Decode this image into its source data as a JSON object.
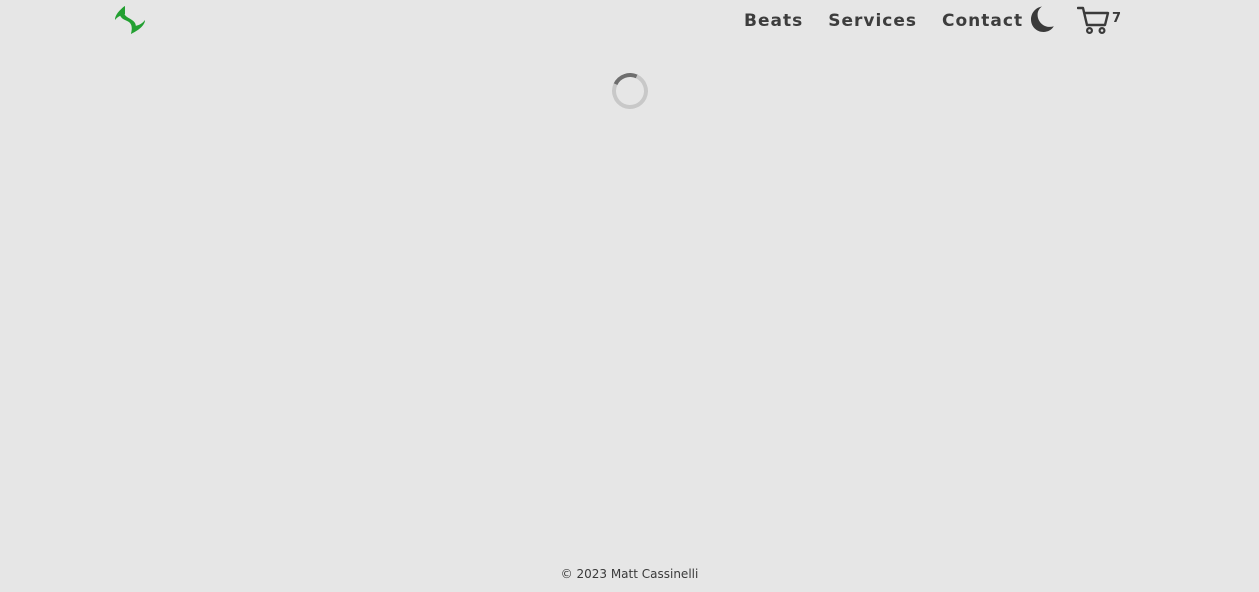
{
  "header": {
    "nav": [
      {
        "label": "Beats"
      },
      {
        "label": "Services"
      },
      {
        "label": "Contact"
      }
    ],
    "theme_toggle_icon": "moon-icon",
    "cart": {
      "icon": "cart-icon",
      "count": "7"
    },
    "logo_icon": "logo-icon"
  },
  "main": {
    "loading_indicator": "spinner"
  },
  "footer": {
    "copyright": "© 2023 Matt Cassinelli"
  },
  "colors": {
    "background": "#e6e6e6",
    "text": "#3a3a3a",
    "logo_green": "#23a032"
  }
}
